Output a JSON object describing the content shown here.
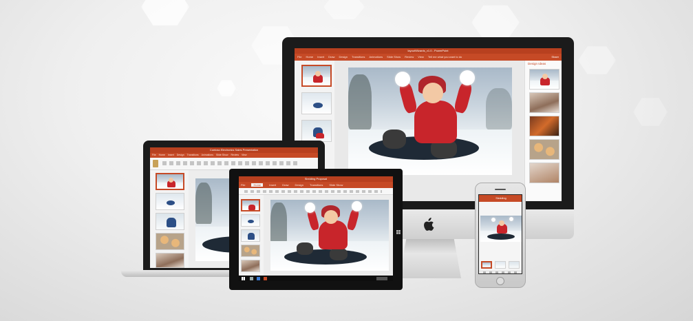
{
  "colors": {
    "accent": "#c64a26",
    "accent_dark": "#b8401f",
    "device_black": "#1b1b1b",
    "silver": "#d8d8d8"
  },
  "icons": [
    "apple-logo-icon",
    "windows-logo-icon"
  ],
  "monitor": {
    "title": "layoutWizards_v1.0 - PowerPoint",
    "tabs": [
      "File",
      "Home",
      "Insert",
      "Draw",
      "Design",
      "Transitions",
      "Animations",
      "Slide Show",
      "Review",
      "View"
    ],
    "tell_me": "Tell me what you want to do",
    "share": "Share",
    "design_ideas_title": "Design Ideas"
  },
  "laptop": {
    "title": "Contoso Electronics Sales Presentation",
    "tabs": [
      "File",
      "Home",
      "Insert",
      "Design",
      "Transitions",
      "Animations",
      "Slide Show",
      "Review",
      "View"
    ]
  },
  "tablet": {
    "title": "Sledding Proposal",
    "tabs": [
      "File",
      "Home",
      "Insert",
      "Draw",
      "Design",
      "Transitions",
      "Slide Show"
    ]
  },
  "phone": {
    "title": "Sledding"
  }
}
